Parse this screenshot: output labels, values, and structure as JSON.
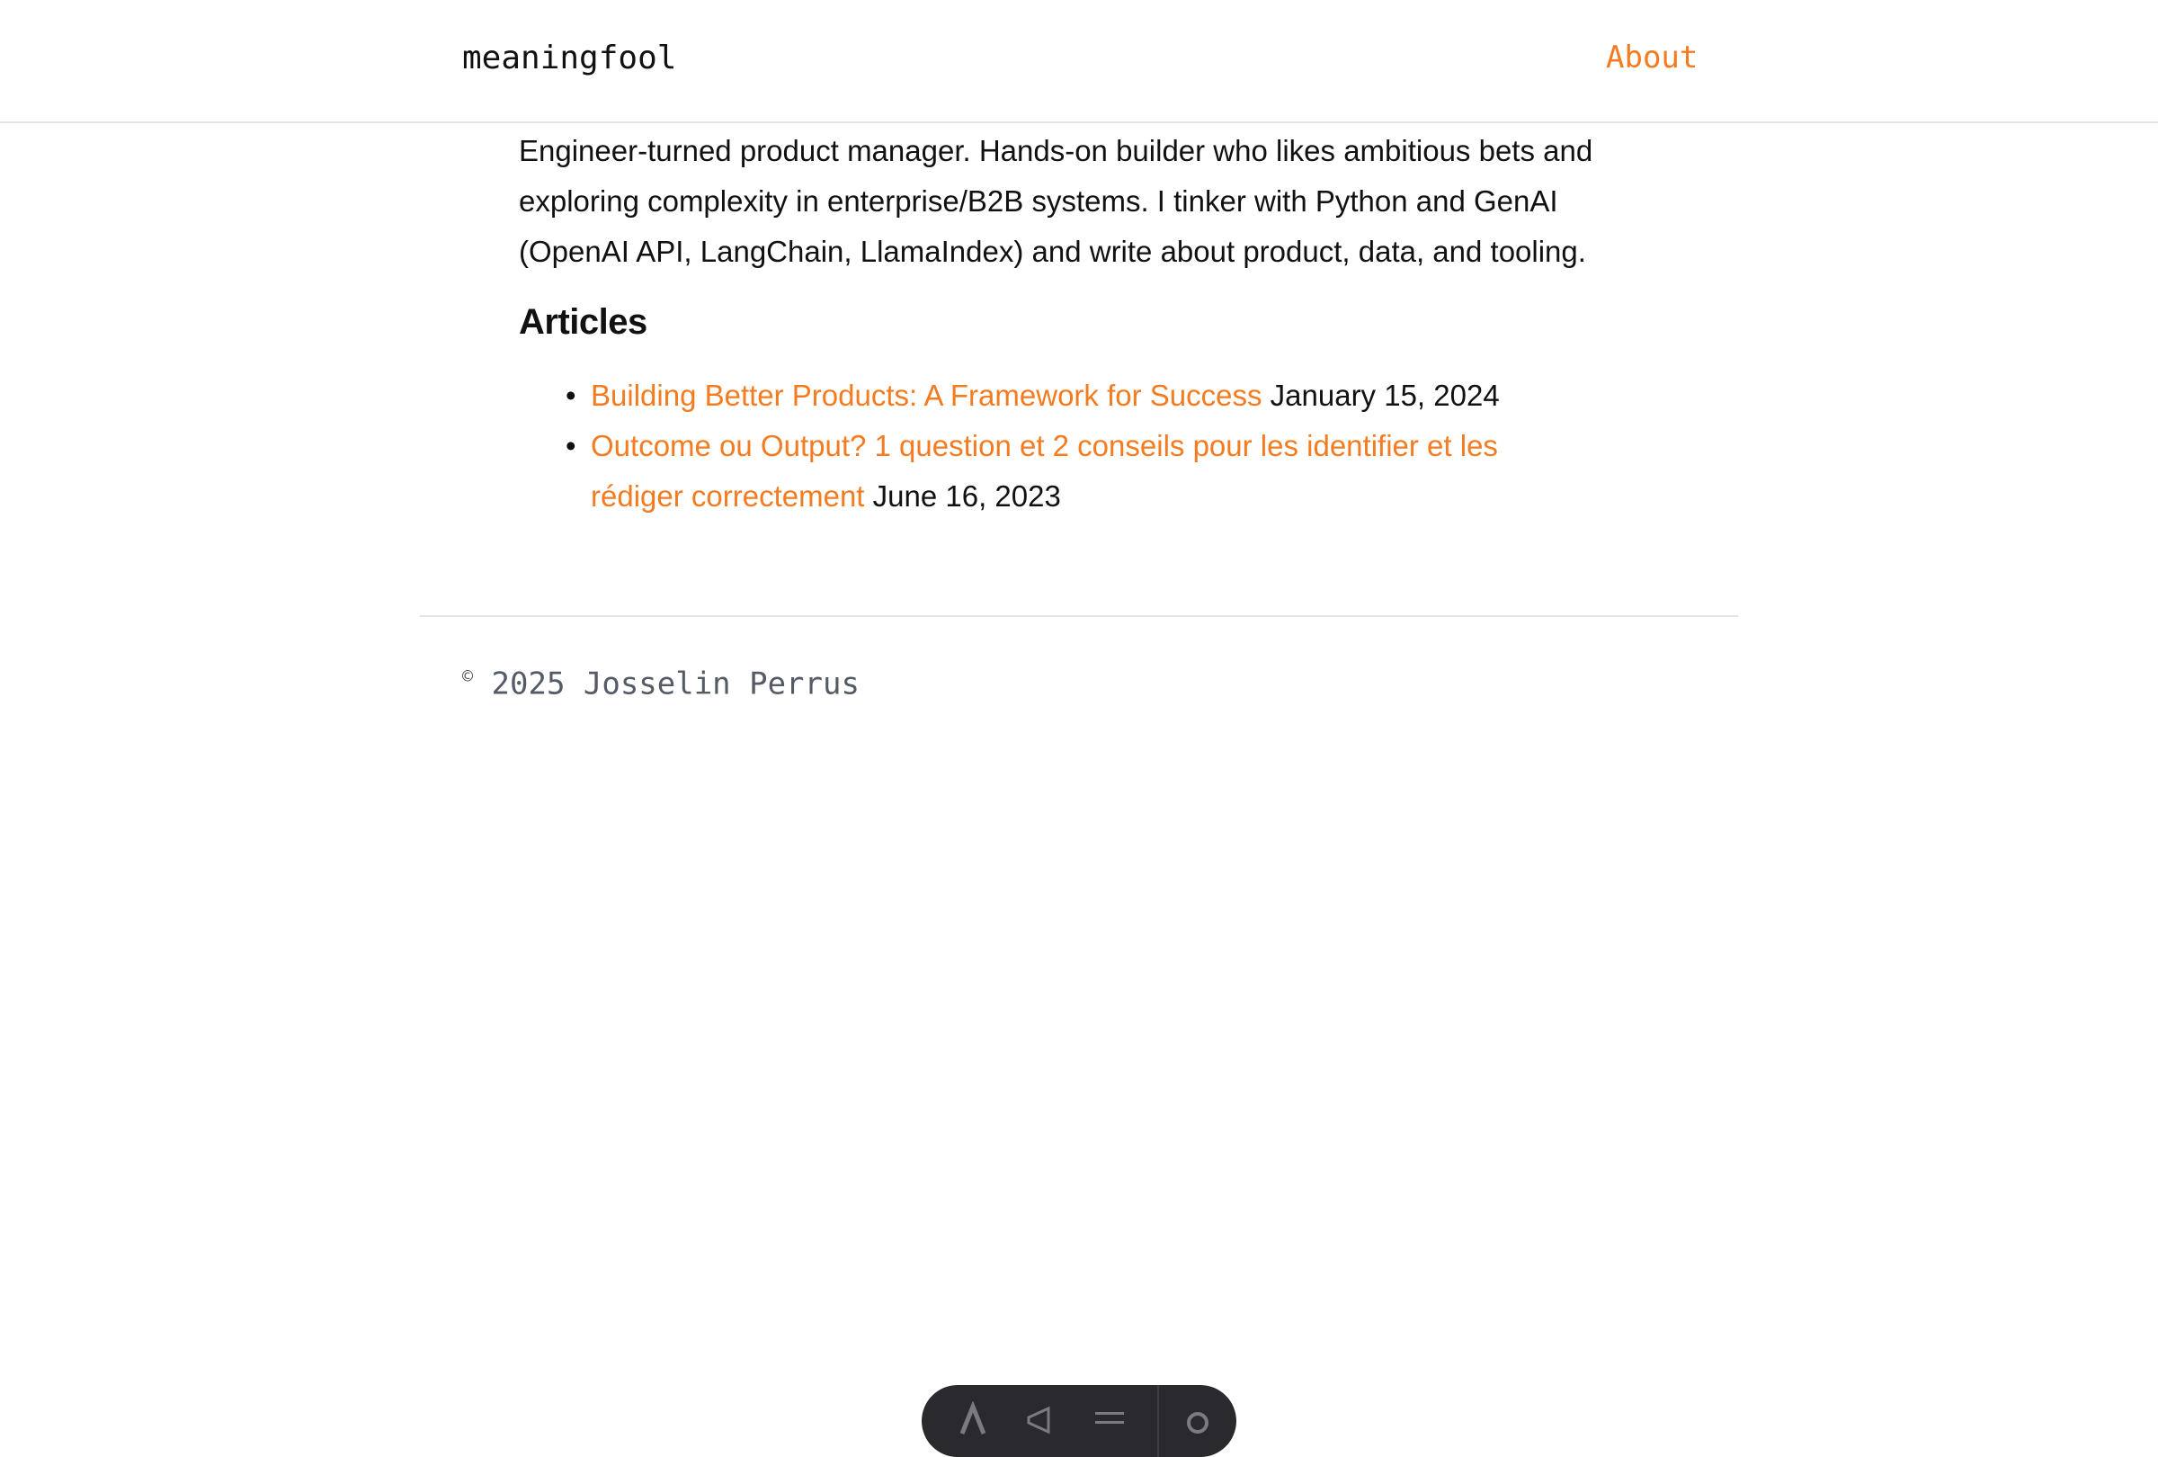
{
  "header": {
    "brand": "meaningfool",
    "nav": {
      "about": "About"
    }
  },
  "main": {
    "bio": "Engineer-turned product manager. Hands-on builder who likes ambitious bets and exploring complexity in enterprise/B2B systems. I tinker with Python and GenAI (OpenAI API, LangChain, LlamaIndex) and write about product, data, and tooling.",
    "articles_heading": "Articles",
    "articles": [
      {
        "title": "Building Better Products: A Framework for Success",
        "date": "January 15, 2024"
      },
      {
        "title": "Outcome ou Output? 1 question et 2 conseils pour les identifier et les rédiger correctement",
        "date": "June 16, 2023"
      }
    ]
  },
  "footer": {
    "copyright_symbol": "©",
    "copyright_text": "2025 Josselin Perrus"
  },
  "toolbar": {
    "icons": [
      "text-size-icon",
      "megaphone-icon",
      "menu-icon",
      "gear-icon"
    ]
  },
  "colors": {
    "accent": "#f47b20",
    "text": "#111111",
    "muted": "#555b66",
    "border": "#e5e5e5",
    "toolbar_bg": "#2a2a2e"
  }
}
